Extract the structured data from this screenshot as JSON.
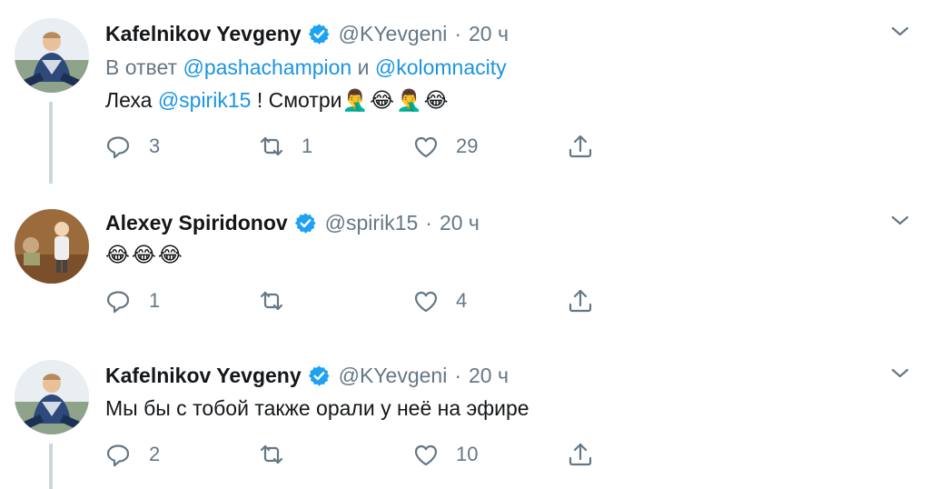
{
  "tweets": [
    {
      "name": "Kafelnikov Yevgeny",
      "handle": "@KYevgeni",
      "dot": "·",
      "time": "20 ч",
      "reply_prefix": "В ответ",
      "reply_user1": "@pashachampion",
      "reply_and": "и",
      "reply_user2": "@kolomnacity",
      "text_start": "Леха",
      "mention": "@spirik15",
      "text_end": "! Смотри",
      "emojis": [
        "🤦‍♂️",
        "😂",
        "🤦‍♂️",
        "😂"
      ],
      "replies": "3",
      "retweets": "1",
      "likes": "29"
    },
    {
      "name": "Alexey Spiridonov",
      "handle": "@spirik15",
      "dot": "·",
      "time": "20 ч",
      "emojis": [
        "😂",
        "😂",
        "😂"
      ],
      "replies": "1",
      "retweets": "",
      "likes": "4"
    },
    {
      "name": "Kafelnikov Yevgeny",
      "handle": "@KYevgeni",
      "dot": "·",
      "time": "20 ч",
      "text": "Мы бы с тобой также орали у неё на эфире",
      "replies": "2",
      "retweets": "",
      "likes": "10"
    }
  ],
  "icons": {
    "verified": "verified-badge-icon",
    "reply": "reply-icon",
    "retweet": "retweet-icon",
    "like": "heart-icon",
    "share": "share-icon",
    "menu": "chevron-down-icon"
  },
  "colors": {
    "link": "#1b95e0",
    "muted": "#657786",
    "verified": "#1da1f2",
    "thread_line": "#ccd6dd"
  }
}
